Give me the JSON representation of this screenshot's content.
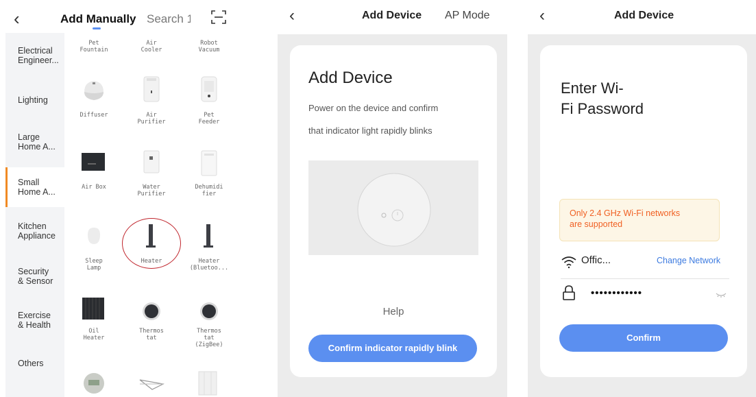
{
  "panel1": {
    "back_icon": "chevron-left-icon",
    "tabs": [
      "Add Manually",
      "Search 1"
    ],
    "scan_icon": "scan-icon",
    "categories": [
      "Electrical\nEngineer...",
      "Lighting",
      "Large\nHome A...",
      "Small\nHome A...",
      "Kitchen\nAppliance",
      "Security\n& Sensor",
      "Exercise\n& Health",
      "Others"
    ],
    "selected_category": 3,
    "devices": [
      "Pet\nFountain",
      "Air\nCooler",
      "Robot\nVacuum",
      "Diffuser",
      "Air\nPurifier",
      "Pet\nFeeder",
      "Air Box",
      "Water\nPurifier",
      "Dehumidi\nfier",
      "Sleep\nLamp",
      "Heater",
      "Heater\n(Bluetoo...",
      "Oil\nHeater",
      "Thermos\ntat",
      "Thermos\ntat\n(ZigBee)"
    ],
    "highlight_color": "#c0262d"
  },
  "panel2": {
    "title": "Add Device",
    "mode": "AP Mode",
    "heading": "Add Device",
    "desc_line1": "Power on the device and confirm",
    "desc_line2": "that indicator light rapidly blinks",
    "help": "Help",
    "confirm_button": "Confirm indicator rapidly blink",
    "accent": "#5b8ff0"
  },
  "panel3": {
    "title": "Add Device",
    "heading_line1": "Enter Wi-",
    "heading_line2": "Fi Password",
    "warning": "Only 2.4 GHz Wi-Fi networks\nare supported",
    "network_name": "Offic...",
    "change_network": "Change Network",
    "password_masked": "••••••••••••",
    "confirm_button": "Confirm",
    "warning_color": "#f06023",
    "link_color": "#3d7be0"
  }
}
